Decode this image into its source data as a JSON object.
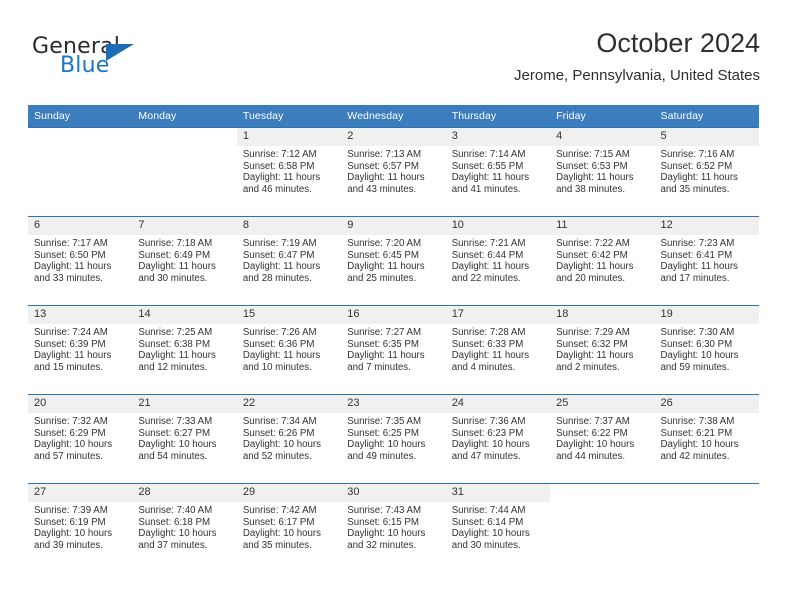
{
  "brand": {
    "name_part1": "General",
    "name_part2": "Blue",
    "logo_icon": "triangle-logo-icon",
    "accent_color": "#1b6cb3"
  },
  "header": {
    "title": "October 2024",
    "subtitle": "Jerome, Pennsylvania, United States"
  },
  "calendar": {
    "header_bg": "#3b7dbd",
    "daynum_bg": "#f0f0f0",
    "row_line_color": "#2e73b0",
    "weekday_headers": [
      "Sunday",
      "Monday",
      "Tuesday",
      "Wednesday",
      "Thursday",
      "Friday",
      "Saturday"
    ],
    "weeks": [
      [
        {
          "day": "",
          "empty": true,
          "sunrise": "",
          "sunset": "",
          "daylight1": "",
          "daylight2": ""
        },
        {
          "day": "",
          "empty": true,
          "sunrise": "",
          "sunset": "",
          "daylight1": "",
          "daylight2": ""
        },
        {
          "day": "1",
          "empty": false,
          "sunrise": "Sunrise: 7:12 AM",
          "sunset": "Sunset: 6:58 PM",
          "daylight1": "Daylight: 11 hours",
          "daylight2": "and 46 minutes."
        },
        {
          "day": "2",
          "empty": false,
          "sunrise": "Sunrise: 7:13 AM",
          "sunset": "Sunset: 6:57 PM",
          "daylight1": "Daylight: 11 hours",
          "daylight2": "and 43 minutes."
        },
        {
          "day": "3",
          "empty": false,
          "sunrise": "Sunrise: 7:14 AM",
          "sunset": "Sunset: 6:55 PM",
          "daylight1": "Daylight: 11 hours",
          "daylight2": "and 41 minutes."
        },
        {
          "day": "4",
          "empty": false,
          "sunrise": "Sunrise: 7:15 AM",
          "sunset": "Sunset: 6:53 PM",
          "daylight1": "Daylight: 11 hours",
          "daylight2": "and 38 minutes."
        },
        {
          "day": "5",
          "empty": false,
          "sunrise": "Sunrise: 7:16 AM",
          "sunset": "Sunset: 6:52 PM",
          "daylight1": "Daylight: 11 hours",
          "daylight2": "and 35 minutes."
        }
      ],
      [
        {
          "day": "6",
          "empty": false,
          "sunrise": "Sunrise: 7:17 AM",
          "sunset": "Sunset: 6:50 PM",
          "daylight1": "Daylight: 11 hours",
          "daylight2": "and 33 minutes."
        },
        {
          "day": "7",
          "empty": false,
          "sunrise": "Sunrise: 7:18 AM",
          "sunset": "Sunset: 6:49 PM",
          "daylight1": "Daylight: 11 hours",
          "daylight2": "and 30 minutes."
        },
        {
          "day": "8",
          "empty": false,
          "sunrise": "Sunrise: 7:19 AM",
          "sunset": "Sunset: 6:47 PM",
          "daylight1": "Daylight: 11 hours",
          "daylight2": "and 28 minutes."
        },
        {
          "day": "9",
          "empty": false,
          "sunrise": "Sunrise: 7:20 AM",
          "sunset": "Sunset: 6:45 PM",
          "daylight1": "Daylight: 11 hours",
          "daylight2": "and 25 minutes."
        },
        {
          "day": "10",
          "empty": false,
          "sunrise": "Sunrise: 7:21 AM",
          "sunset": "Sunset: 6:44 PM",
          "daylight1": "Daylight: 11 hours",
          "daylight2": "and 22 minutes."
        },
        {
          "day": "11",
          "empty": false,
          "sunrise": "Sunrise: 7:22 AM",
          "sunset": "Sunset: 6:42 PM",
          "daylight1": "Daylight: 11 hours",
          "daylight2": "and 20 minutes."
        },
        {
          "day": "12",
          "empty": false,
          "sunrise": "Sunrise: 7:23 AM",
          "sunset": "Sunset: 6:41 PM",
          "daylight1": "Daylight: 11 hours",
          "daylight2": "and 17 minutes."
        }
      ],
      [
        {
          "day": "13",
          "empty": false,
          "sunrise": "Sunrise: 7:24 AM",
          "sunset": "Sunset: 6:39 PM",
          "daylight1": "Daylight: 11 hours",
          "daylight2": "and 15 minutes."
        },
        {
          "day": "14",
          "empty": false,
          "sunrise": "Sunrise: 7:25 AM",
          "sunset": "Sunset: 6:38 PM",
          "daylight1": "Daylight: 11 hours",
          "daylight2": "and 12 minutes."
        },
        {
          "day": "15",
          "empty": false,
          "sunrise": "Sunrise: 7:26 AM",
          "sunset": "Sunset: 6:36 PM",
          "daylight1": "Daylight: 11 hours",
          "daylight2": "and 10 minutes."
        },
        {
          "day": "16",
          "empty": false,
          "sunrise": "Sunrise: 7:27 AM",
          "sunset": "Sunset: 6:35 PM",
          "daylight1": "Daylight: 11 hours",
          "daylight2": "and 7 minutes."
        },
        {
          "day": "17",
          "empty": false,
          "sunrise": "Sunrise: 7:28 AM",
          "sunset": "Sunset: 6:33 PM",
          "daylight1": "Daylight: 11 hours",
          "daylight2": "and 4 minutes."
        },
        {
          "day": "18",
          "empty": false,
          "sunrise": "Sunrise: 7:29 AM",
          "sunset": "Sunset: 6:32 PM",
          "daylight1": "Daylight: 11 hours",
          "daylight2": "and 2 minutes."
        },
        {
          "day": "19",
          "empty": false,
          "sunrise": "Sunrise: 7:30 AM",
          "sunset": "Sunset: 6:30 PM",
          "daylight1": "Daylight: 10 hours",
          "daylight2": "and 59 minutes."
        }
      ],
      [
        {
          "day": "20",
          "empty": false,
          "sunrise": "Sunrise: 7:32 AM",
          "sunset": "Sunset: 6:29 PM",
          "daylight1": "Daylight: 10 hours",
          "daylight2": "and 57 minutes."
        },
        {
          "day": "21",
          "empty": false,
          "sunrise": "Sunrise: 7:33 AM",
          "sunset": "Sunset: 6:27 PM",
          "daylight1": "Daylight: 10 hours",
          "daylight2": "and 54 minutes."
        },
        {
          "day": "22",
          "empty": false,
          "sunrise": "Sunrise: 7:34 AM",
          "sunset": "Sunset: 6:26 PM",
          "daylight1": "Daylight: 10 hours",
          "daylight2": "and 52 minutes."
        },
        {
          "day": "23",
          "empty": false,
          "sunrise": "Sunrise: 7:35 AM",
          "sunset": "Sunset: 6:25 PM",
          "daylight1": "Daylight: 10 hours",
          "daylight2": "and 49 minutes."
        },
        {
          "day": "24",
          "empty": false,
          "sunrise": "Sunrise: 7:36 AM",
          "sunset": "Sunset: 6:23 PM",
          "daylight1": "Daylight: 10 hours",
          "daylight2": "and 47 minutes."
        },
        {
          "day": "25",
          "empty": false,
          "sunrise": "Sunrise: 7:37 AM",
          "sunset": "Sunset: 6:22 PM",
          "daylight1": "Daylight: 10 hours",
          "daylight2": "and 44 minutes."
        },
        {
          "day": "26",
          "empty": false,
          "sunrise": "Sunrise: 7:38 AM",
          "sunset": "Sunset: 6:21 PM",
          "daylight1": "Daylight: 10 hours",
          "daylight2": "and 42 minutes."
        }
      ],
      [
        {
          "day": "27",
          "empty": false,
          "sunrise": "Sunrise: 7:39 AM",
          "sunset": "Sunset: 6:19 PM",
          "daylight1": "Daylight: 10 hours",
          "daylight2": "and 39 minutes."
        },
        {
          "day": "28",
          "empty": false,
          "sunrise": "Sunrise: 7:40 AM",
          "sunset": "Sunset: 6:18 PM",
          "daylight1": "Daylight: 10 hours",
          "daylight2": "and 37 minutes."
        },
        {
          "day": "29",
          "empty": false,
          "sunrise": "Sunrise: 7:42 AM",
          "sunset": "Sunset: 6:17 PM",
          "daylight1": "Daylight: 10 hours",
          "daylight2": "and 35 minutes."
        },
        {
          "day": "30",
          "empty": false,
          "sunrise": "Sunrise: 7:43 AM",
          "sunset": "Sunset: 6:15 PM",
          "daylight1": "Daylight: 10 hours",
          "daylight2": "and 32 minutes."
        },
        {
          "day": "31",
          "empty": false,
          "sunrise": "Sunrise: 7:44 AM",
          "sunset": "Sunset: 6:14 PM",
          "daylight1": "Daylight: 10 hours",
          "daylight2": "and 30 minutes."
        },
        {
          "day": "",
          "empty": true,
          "sunrise": "",
          "sunset": "",
          "daylight1": "",
          "daylight2": ""
        },
        {
          "day": "",
          "empty": true,
          "sunrise": "",
          "sunset": "",
          "daylight1": "",
          "daylight2": ""
        }
      ]
    ]
  }
}
